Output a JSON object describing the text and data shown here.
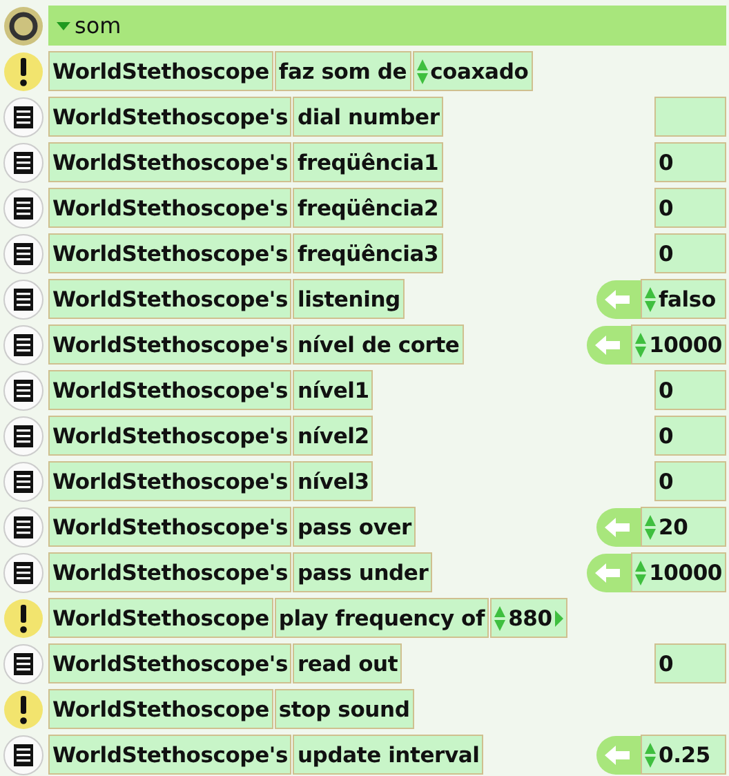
{
  "header": {
    "title": "som",
    "expanded": true
  },
  "rows": [
    {
      "kind": "command",
      "object": "WorldStethoscope",
      "label": "faz som de",
      "arg": {
        "text": "coaxado",
        "more": false
      }
    },
    {
      "kind": "reporter",
      "object": "WorldStethoscope's",
      "label": "dial number",
      "readout": {
        "settable": false
      }
    },
    {
      "kind": "reporter",
      "object": "WorldStethoscope's",
      "label": "freqüência1",
      "readout": {
        "settable": false,
        "value": "0"
      }
    },
    {
      "kind": "reporter",
      "object": "WorldStethoscope's",
      "label": "freqüência2",
      "readout": {
        "settable": false,
        "value": "0"
      }
    },
    {
      "kind": "reporter",
      "object": "WorldStethoscope's",
      "label": "freqüência3",
      "readout": {
        "settable": false,
        "value": "0"
      }
    },
    {
      "kind": "reporter",
      "object": "WorldStethoscope's",
      "label": "listening",
      "readout": {
        "settable": true,
        "value": "falso"
      }
    },
    {
      "kind": "reporter",
      "object": "WorldStethoscope's",
      "label": "nível de corte",
      "readout": {
        "settable": true,
        "value": "10000"
      }
    },
    {
      "kind": "reporter",
      "object": "WorldStethoscope's",
      "label": "nível1",
      "readout": {
        "settable": false,
        "value": "0"
      }
    },
    {
      "kind": "reporter",
      "object": "WorldStethoscope's",
      "label": "nível2",
      "readout": {
        "settable": false,
        "value": "0"
      }
    },
    {
      "kind": "reporter",
      "object": "WorldStethoscope's",
      "label": "nível3",
      "readout": {
        "settable": false,
        "value": "0"
      }
    },
    {
      "kind": "reporter",
      "object": "WorldStethoscope's",
      "label": "pass over",
      "readout": {
        "settable": true,
        "value": "20"
      }
    },
    {
      "kind": "reporter",
      "object": "WorldStethoscope's",
      "label": "pass under",
      "readout": {
        "settable": true,
        "value": "10000"
      }
    },
    {
      "kind": "command",
      "object": "WorldStethoscope",
      "label": "play frequency of",
      "arg": {
        "text": "880",
        "more": true
      }
    },
    {
      "kind": "reporter",
      "object": "WorldStethoscope's",
      "label": "read out",
      "readout": {
        "settable": false,
        "value": "0"
      }
    },
    {
      "kind": "command",
      "object": "WorldStethoscope",
      "label": "stop sound"
    },
    {
      "kind": "reporter",
      "object": "WorldStethoscope's",
      "label": "update interval",
      "readout": {
        "settable": true,
        "value": "0.25"
      }
    }
  ]
}
